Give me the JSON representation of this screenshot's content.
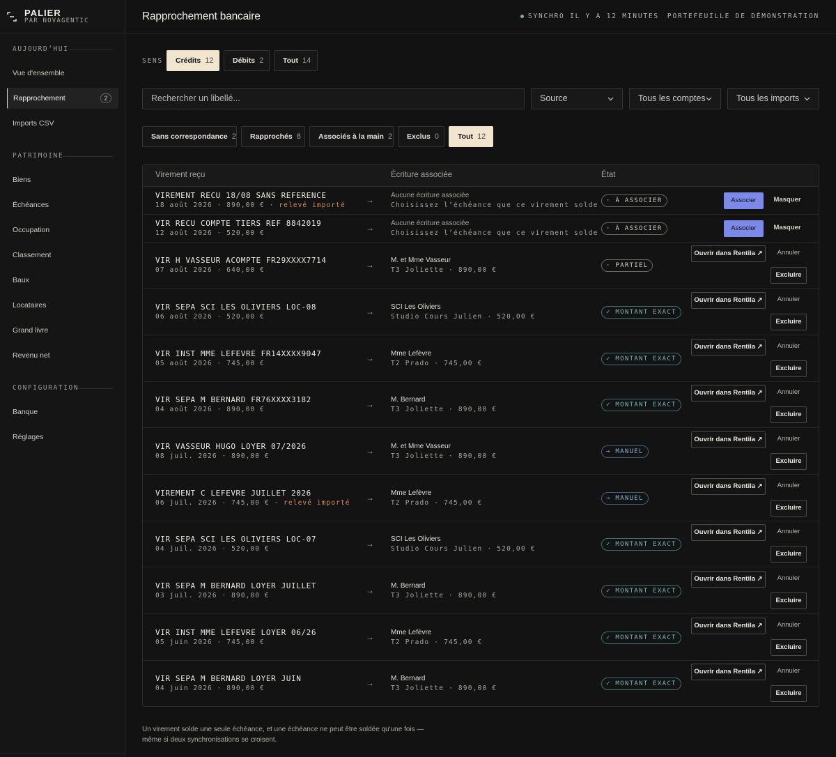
{
  "brand": {
    "name": "PALIER",
    "sub": "PAR NOVAGENTIC"
  },
  "sidebar": {
    "sections": [
      {
        "title": "AUJOURD’HUI",
        "items": [
          {
            "label": "Vue d'ensemble"
          },
          {
            "label": "Rapprochement",
            "badge": "2",
            "active": true
          },
          {
            "label": "Imports CSV"
          }
        ]
      },
      {
        "title": "PATRIMOINE",
        "items": [
          {
            "label": "Biens"
          },
          {
            "label": "Échéances"
          },
          {
            "label": "Occupation"
          },
          {
            "label": "Classement"
          },
          {
            "label": "Baux"
          },
          {
            "label": "Locataires"
          },
          {
            "label": "Grand livre"
          },
          {
            "label": "Revenu net"
          }
        ]
      },
      {
        "title": "CONFIGURATION",
        "items": [
          {
            "label": "Banque"
          },
          {
            "label": "Réglages"
          }
        ]
      }
    ]
  },
  "header": {
    "title": "Rapprochement bancaire",
    "sync": "SYNCHRO IL Y A 12 MINUTES",
    "portfolio": "PORTEFEUILLE DE DÉMONSTRATION"
  },
  "sens": {
    "label": "SENS",
    "options": [
      {
        "label": "Crédits",
        "count": "12",
        "active": true
      },
      {
        "label": "Débits",
        "count": "2"
      },
      {
        "label": "Tout",
        "count": "14"
      }
    ]
  },
  "filters": {
    "search_placeholder": "Rechercher un libellé...",
    "source": "Source",
    "accounts": "Tous les comptes",
    "imports": "Tous les imports"
  },
  "status_tabs": [
    {
      "label": "Sans correspondance",
      "count": "2"
    },
    {
      "label": "Rapprochés",
      "count": "8"
    },
    {
      "label": "Associés à la main",
      "count": "2"
    },
    {
      "label": "Exclus",
      "count": "0"
    },
    {
      "label": "Tout",
      "count": "12",
      "active": true
    }
  ],
  "table": {
    "headers": {
      "transfer": "Virement reçu",
      "entry": "Écriture associée",
      "state": "État"
    },
    "arrow": "→",
    "actions": {
      "associate": "Associer",
      "hide": "Masquer",
      "open": "Ouvrir dans Rentila ↗",
      "cancel": "Annuler",
      "exclude": "Excluire"
    },
    "rows": [
      {
        "title": "VIREMENT RECU 18/08 SANS REFERENCE",
        "sub": "18 août 2026 · 890,00 €",
        "flag": " · relevé importé",
        "match": "Aucune écriture associée",
        "match_sub": "Choisissez l’échéance que ce virement solde",
        "state": "· À ASSOCIER",
        "kind": "todo"
      },
      {
        "title": "VIR RECU COMPTE TIERS REF 8842019",
        "sub": "12 août 2026 · 520,00 €",
        "match": "Aucune écriture associée",
        "match_sub": "Choisissez l’échéance que ce virement solde",
        "state": "· À ASSOCIER",
        "kind": "todo"
      },
      {
        "title": "VIR H VASSEUR ACOMPTE FR29XXXX7714",
        "sub": "07 août 2026 · 640,00 €",
        "match": "M. et Mme Vasseur",
        "match_sub": "T3 Joliette · 890,00 €",
        "state": "· PARTIEL",
        "kind": "partial"
      },
      {
        "title": "VIR SEPA SCI LES OLIVIERS LOC-08",
        "sub": "06 août 2026 · 520,00 €",
        "match": "SCI Les Oliviers",
        "match_sub": "Studio Cours Julien · 520,00 €",
        "state": "✓ MONTANT EXACT",
        "kind": "exact"
      },
      {
        "title": "VIR INST MME LEFEVRE FR14XXXX9047",
        "sub": "05 août 2026 · 745,00 €",
        "match": "Mme Lefèvre",
        "match_sub": "T2 Prado · 745,00 €",
        "state": "✓ MONTANT EXACT",
        "kind": "exact"
      },
      {
        "title": "VIR SEPA M BERNARD FR76XXXX3182",
        "sub": "04 août 2026 · 890,00 €",
        "match": "M. Bernard",
        "match_sub": "T3 Joliette · 890,00 €",
        "state": "✓ MONTANT EXACT",
        "kind": "exact"
      },
      {
        "title": "VIR VASSEUR HUGO LOYER 07/2026",
        "sub": "08 juil. 2026 · 890,00 €",
        "match": "M. et Mme Vasseur",
        "match_sub": "T3 Joliette · 890,00 €",
        "state": "→ MANUEL",
        "kind": "manual"
      },
      {
        "title": "VIREMENT C LEFEVRE JUILLET 2026",
        "sub": "06 juil. 2026 · 745,00 €",
        "flag": " · relevé importé",
        "match": "Mme Lefèvre",
        "match_sub": "T2 Prado · 745,00 €",
        "state": "→ MANUEL",
        "kind": "manual"
      },
      {
        "title": "VIR SEPA SCI LES OLIVIERS LOC-07",
        "sub": "04 juil. 2026 · 520,00 €",
        "match": "SCI Les Oliviers",
        "match_sub": "Studio Cours Julien · 520,00 €",
        "state": "✓ MONTANT EXACT",
        "kind": "exact"
      },
      {
        "title": "VIR SEPA M BERNARD LOYER JUILLET",
        "sub": "03 juil. 2026 · 890,00 €",
        "match": "M. Bernard",
        "match_sub": "T3 Joliette · 890,00 €",
        "state": "✓ MONTANT EXACT",
        "kind": "exact"
      },
      {
        "title": "VIR INST MME LEFEVRE LOYER 06/26",
        "sub": "05 juin 2026 · 745,00 €",
        "match": "Mme Lefèvre",
        "match_sub": "T2 Prado · 745,00 €",
        "state": "✓ MONTANT EXACT",
        "kind": "exact"
      },
      {
        "title": "VIR SEPA M BERNARD LOYER JUIN",
        "sub": "04 juin 2026 · 890,00 €",
        "match": "M. Bernard",
        "match_sub": "T3 Joliette · 890,00 €",
        "state": "✓ MONTANT EXACT",
        "kind": "exact"
      }
    ]
  },
  "footnote": "Un virement solde une seule échéance, et une échéance ne peut être soldée qu'une fois — même si deux synchronisations se croisent."
}
